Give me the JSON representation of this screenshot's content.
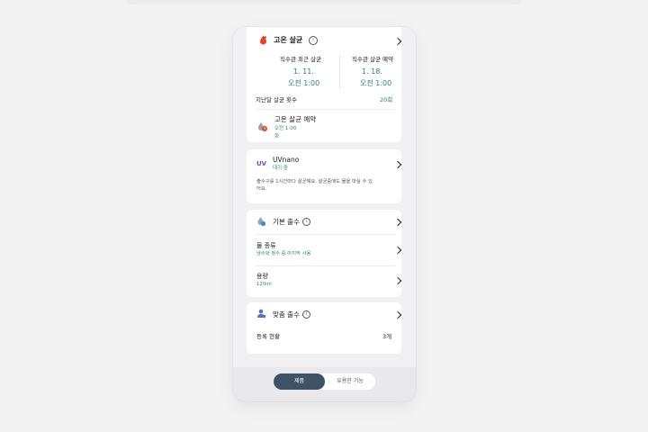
{
  "sterilization": {
    "title": "고온 살균",
    "last_label": "직수관 최근 살균",
    "last_date": "1. 11.",
    "last_time": "오전 1:00",
    "reserve_label": "직수관 살균 예약",
    "reserve_date": "1. 18.",
    "reserve_time": "오전 1:00",
    "count_label": "지난달 살균 횟수",
    "count_value": "20회",
    "schedule_title": "고온 살균 예약",
    "schedule_time": "오전 1:00",
    "schedule_day": "화"
  },
  "uvnano": {
    "badge": "UV",
    "title": "UVnano",
    "status": "대기 중",
    "description_line1": "출수구를 1시간마다 살균해요. 살균중에도 물을 마실 수 있",
    "description_line2": "어요."
  },
  "basic_dispense": {
    "title": "기본 출수",
    "water_type_label": "물 종류",
    "water_type_value": "냉수와 정수 중 마지막 사용",
    "volume_label": "용량",
    "volume_value": "120ml"
  },
  "custom_dispense": {
    "title": "맞춤 출수",
    "registered_label": "등록 현황",
    "registered_value": "3개"
  },
  "bottom_tabs": {
    "control": "제품",
    "features": "유용한 기능"
  },
  "colors": {
    "accent_teal": "#2d7f7b",
    "tab_active": "#3f5266",
    "uv_purple": "#6a4fc4",
    "sterilize_red": "#e0452f"
  }
}
